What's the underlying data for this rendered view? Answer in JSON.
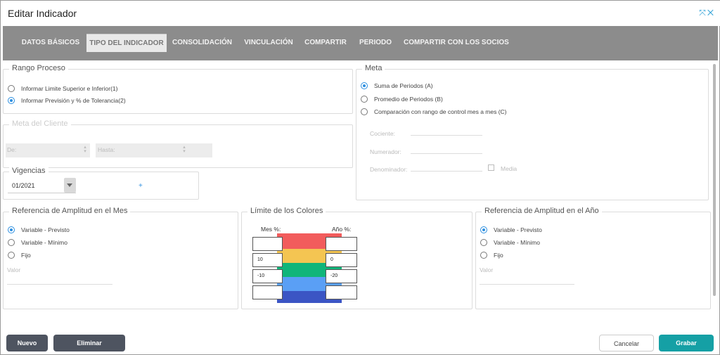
{
  "window": {
    "title": "Editar Indicador",
    "icons": "⤧✕"
  },
  "tabs": [
    {
      "label": "DATOS BÁSICOS",
      "active": false
    },
    {
      "label": "TIPO DEL INDICADOR",
      "active": true
    },
    {
      "label": "CONSOLIDACIÓN",
      "active": false
    },
    {
      "label": "VINCULACIÓN",
      "active": false
    },
    {
      "label": "COMPARTIR",
      "active": false
    },
    {
      "label": "PERIODO",
      "active": false
    },
    {
      "label": "COMPARTIR CON LOS SOCIOS",
      "active": false
    }
  ],
  "rango": {
    "legend": "Rango Proceso",
    "options": [
      {
        "label": "Informar Limite Superior e Inferior(1)",
        "checked": false
      },
      {
        "label": "Informar Previsión y % de Tolerancia(2)",
        "checked": true
      }
    ]
  },
  "meta_cliente": {
    "legend": "Meta del Cliente",
    "de": "De:",
    "hasta": "Hasta:"
  },
  "vigencias": {
    "legend": "Vigencias",
    "value": "01/2021",
    "add": "+"
  },
  "meta": {
    "legend": "Meta",
    "options": [
      {
        "label": "Suma de Periodos (A)",
        "checked": true
      },
      {
        "label": "Promedio de Periodos (B)",
        "checked": false
      },
      {
        "label": "Comparación con rango de control mes a mes (C)",
        "checked": false
      }
    ],
    "cociente": "Cociente:",
    "numerador": "Numerador:",
    "denominador": "Denominador:",
    "media": "Media"
  },
  "ref_mes": {
    "legend": "Referencia de Amplitud en el Mes",
    "options": [
      {
        "label": "Variable - Previsto",
        "checked": true
      },
      {
        "label": "Variable - Mínimo",
        "checked": false
      },
      {
        "label": "Fijo",
        "checked": false
      }
    ],
    "valor": "Valor"
  },
  "colores": {
    "legend": "Límite de los Colores",
    "mes_label": "Mes %:",
    "ano_label": "Año %:",
    "mes_values": [
      "",
      "10",
      "-10",
      ""
    ],
    "ano_values": [
      "",
      "0",
      "-20",
      ""
    ],
    "bands": [
      "#f25c5c",
      "#f4c552",
      "#11b57a",
      "#5a9ff5",
      "#3b55c4"
    ]
  },
  "ref_ano": {
    "legend": "Referencia de Amplitud en el Año",
    "options": [
      {
        "label": "Variable - Previsto",
        "checked": true
      },
      {
        "label": "Variable - Mínimo",
        "checked": false
      },
      {
        "label": "Fijo",
        "checked": false
      }
    ],
    "valor": "Valor"
  },
  "buttons": {
    "nuevo": "Nuevo",
    "eliminar": "Eliminar",
    "cancelar": "Cancelar",
    "grabar": "Grabar"
  }
}
